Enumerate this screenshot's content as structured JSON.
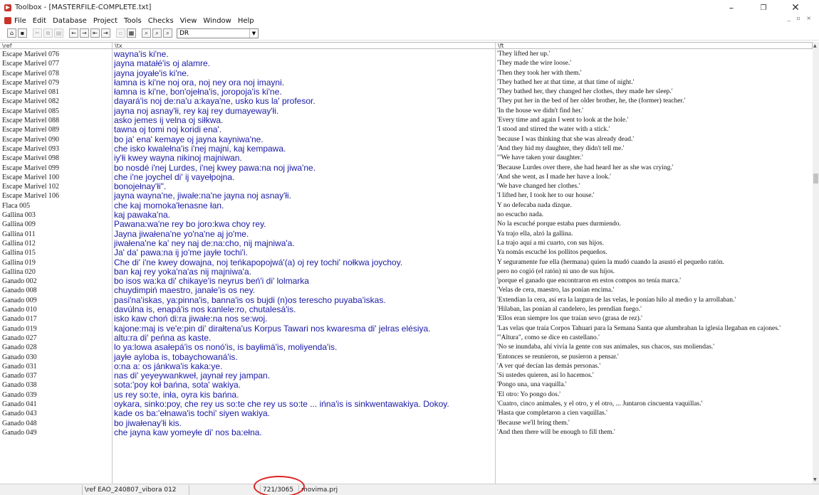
{
  "window": {
    "title": "Toolbox - [MASTERFILE-COMPLETE.txt]",
    "min_glyph": "–",
    "max_glyph": "❐",
    "close_glyph": "✕"
  },
  "menu": [
    "File",
    "Edit",
    "Database",
    "Project",
    "Tools",
    "Checks",
    "View",
    "Window",
    "Help"
  ],
  "mdi_controls": "_ ▫ ×",
  "toolbar": {
    "filter_value": "DR"
  },
  "columns": {
    "ref_header": "\\ref",
    "tx_header": "\\tx",
    "ft_header": "\\ft"
  },
  "rows": [
    {
      "ref": "Escape Marivel 076",
      "tx": "wayna'is ki'ne.",
      "ft": "'They lifted her up.'"
    },
    {
      "ref": "Escape Marivel 077",
      "tx": "jayna matałé'is oj alamre.",
      "ft": "'They made the wire loose.'"
    },
    {
      "ref": "Escape Marivel 078",
      "tx": "jayna joyałe'is ki'ne.",
      "ft": "'Then they took her with them.'"
    },
    {
      "ref": "Escape Marivel 079",
      "tx": "łamna is ki'ne noj ora, noj ney ora noj imayni.",
      "ft": "'They bathed her at that time, at that time of night.'"
    },
    {
      "ref": "Escape Marivel 081",
      "tx": "łamna is ki'ne, bon'ojełna'is, joropoja'is ki'ne.",
      "ft": "'They bathed her, they changed her clothes, they made her sleep.'"
    },
    {
      "ref": "Escape Marivel 082",
      "tx": "dayará'is noj de:na'u a:kaya'ne, usko kus la' profesor.",
      "ft": "'They put her in the bed of her older brother, he, the (former) teacher.'"
    },
    {
      "ref": "Escape Marivel 085",
      "tx": "jayna noj asnay'łi, rey kaj rey dumayeway'łi.",
      "ft": "'In the house we didn't find her.'"
    },
    {
      "ref": "Escape Marivel 088",
      "tx": "asko jemes ij velna oj siłkwa.",
      "ft": "'Every time and again I went to look at the hole.'"
    },
    {
      "ref": "Escape Marivel 089",
      "tx": "tawna oj tomi noj koridi ena'.",
      "ft": "'I stood and stirred the water with a stick.'"
    },
    {
      "ref": "Escape Marivel 090",
      "tx": "bo ja' ena' kemaye oj jayna kayniwa'ne.",
      "ft": "'because I was thinking that she was already dead.'"
    },
    {
      "ref": "Escape Marivel 093",
      "tx": "che isko kwalełna'is i'nej majni, kaj kempawa.",
      "ft": "'And they hid my daughter, they didn't tell me.'"
    },
    {
      "ref": "Escape Marivel 098",
      "tx": "iy'łi kwey wayna nikinoj majniwan.",
      "ft": "'\"We have taken your daughter.'"
    },
    {
      "ref": "Escape Marivel 099",
      "tx": "bo nosdé i'nej Lurdes, i'nej kwey pawa:na noj jiwa'ne.",
      "ft": "'Because Lurdes over there, she had heard her as she was crying.'"
    },
    {
      "ref": "Escape Marivel 100",
      "tx": "che i'ne joychel di' ij vayełpojna.",
      "ft": "'And she went, as I made her have a look.'"
    },
    {
      "ref": "Escape Marivel 102",
      "tx": "bonojełnay'łi\".",
      "ft": "'We have changed her clothes.'"
    },
    {
      "ref": "Escape Marivel 106",
      "tx": "jayna wayna'ne, jiwałe:na'ne jayna noj asnay'łi.",
      "ft": "'I lifted her, I took her to our house.'"
    },
    {
      "ref": "Flaca 005",
      "tx": "che kaj momoka'łenasne łan.",
      "ft": "Y no defecaba nada dizque."
    },
    {
      "ref": "Gallina 003",
      "tx": "kaj pawaka'na.",
      "ft": "no escucho nada."
    },
    {
      "ref": "Gallina 009",
      "tx": "Pawana:wa'ne rey bo joro:kwa choy rey.",
      "ft": "No la escuché porque estaba pues durmiendo."
    },
    {
      "ref": "Gallina 011",
      "tx": "Jayna jiwałena'ne yo'na'ne aj jo'me.",
      "ft": "Ya trajo ella, alzó la gallina."
    },
    {
      "ref": "Gallina 012",
      "tx": "jiwałena'ne ka' ney naj de:na:cho, nij majniwa'a.",
      "ft": "La trajo aquí a mi cuarto, con sus hijos."
    },
    {
      "ref": "Gallina 015",
      "tx": "Ja' da' pawa:na ij jo'me jayłe tochi'i.",
      "ft": "Ya nomás escuché los pollitos pequeños."
    },
    {
      "ref": "Gallina 019",
      "tx": "Che di' i'ne kwey dowajna, noj teńkapopojwá'(a) oj rey tochi' nołkwa joychoy.",
      "ft": "Y seguramente fue ella (hermana) quien la mudó cuando la asustó el pequeño ratón."
    },
    {
      "ref": "Gallina 020",
      "tx": "ban kaj rey yoka'na'as nij majniwa'a.",
      "ft": "pero no cogió (el ratón) ni uno de sus hijos."
    },
    {
      "ref": "Ganado 002",
      "tx": "bo isos wa:ka di' chikaye'is neyrus beń'i di' lolmarka",
      "ft": "'porque el ganado que encontraron en estos compos no tenía marca.'"
    },
    {
      "ref": "Ganado 008",
      "tx": "chuydimpiń maestro, janałe'is os ney.",
      "ft": "'Velas de cera, maestro, las ponían encima.'"
    },
    {
      "ref": "Ganado 009",
      "tx": "pasi'na'iskas, ya:pinna'is, banna'is os bujdi (n)os terescho puyaba'iskas.",
      "ft": "'Extendían la cera, así era la largura de las velas, le ponían hilo al medio y la arrollaban.'"
    },
    {
      "ref": "Ganado 010",
      "tx": "davúlna is, enapá'is nos kanlele:ro, chutalesá'is.",
      "ft": "'Hilaban, las ponían al candelero, les prendían fuego.'"
    },
    {
      "ref": "Ganado 017",
      "tx": "isko kaw choń di:ra jiwałe:na nos se:woj.",
      "ft": "'Ellos eran siempre los que traían sevo (grasa de rez).'"
    },
    {
      "ref": "Ganado 019",
      "tx": "kajone:maj is ve'e:pin di' dirałtena'us Korpus Tawari nos kwaresma di' jelras elésiya.",
      "ft": "'Las velas que traía Corpos Tahuari para la Semana Santa que alumbraban la iglesia llegaban en cajones.'"
    },
    {
      "ref": "Ganado 027",
      "tx": "altu:ra di' peńna as kaste.",
      "ft": "'\"Altura\", como se dice en castellano.'"
    },
    {
      "ref": "Ganado 028",
      "tx": "lo ya:lowa asałepá'is os nonó'is, is bayłimá'is, moliyenda'is.",
      "ft": "'No se inundaba, ahí vivía la gente con sus animales, sus chacos, sus moliendas.'"
    },
    {
      "ref": "Ganado 030",
      "tx": "jayłe ayloba is, tobaychowaná'is.",
      "ft": "'Entonces se reunieron, se pusieron a pensar.'"
    },
    {
      "ref": "Ganado 031",
      "tx": "o:na a: os jánkwa'is kaka:ye.",
      "ft": "'A ver qué decían las demás personas.'"
    },
    {
      "ref": "Ganado 037",
      "tx": "nas di' yeyeywankweł, jaynał rey jampan.",
      "ft": "'Si ustedes quieren, así lo hacemos.'"
    },
    {
      "ref": "Ganado 038",
      "tx": "sota:'poy koł bańna, sota' wakiya.",
      "ft": "'Pongo una, una vaquilla.'"
    },
    {
      "ref": "Ganado 039",
      "tx": "us rey so:te, inła, oyra kis bańna.",
      "ft": "'El otro: Yo pongo dos.'"
    },
    {
      "ref": "Ganado 041",
      "tx": "oykara, sinko:poy, che rey us so:te che rey us so:te ... ińna'is is sinkwentawakiya. Dokoy.",
      "ft": "'Cuatro, cinco animales, y el otro, y el otro, ... Juntaron  cincuenta vaquillas.'"
    },
    {
      "ref": "Ganado 043",
      "tx": "kade os ba:'ełnawa'is tochi' siyen wakiya.",
      "ft": "'Hasta que completaron a cien vaquillas.'"
    },
    {
      "ref": "Ganado 048",
      "tx": "bo jiwałenay'łi kis.",
      "ft": "'Because we'll bring them.'"
    },
    {
      "ref": "Ganado 049",
      "tx": "che jayna kaw yomeyłe di' nos ba:ełna.",
      "ft": "'And then there will be enough to fill them.'"
    }
  ],
  "status": {
    "current_ref": "\\ref EAO_240807_vibora 012",
    "record_count": "721/3065",
    "project": "movima.prj"
  }
}
